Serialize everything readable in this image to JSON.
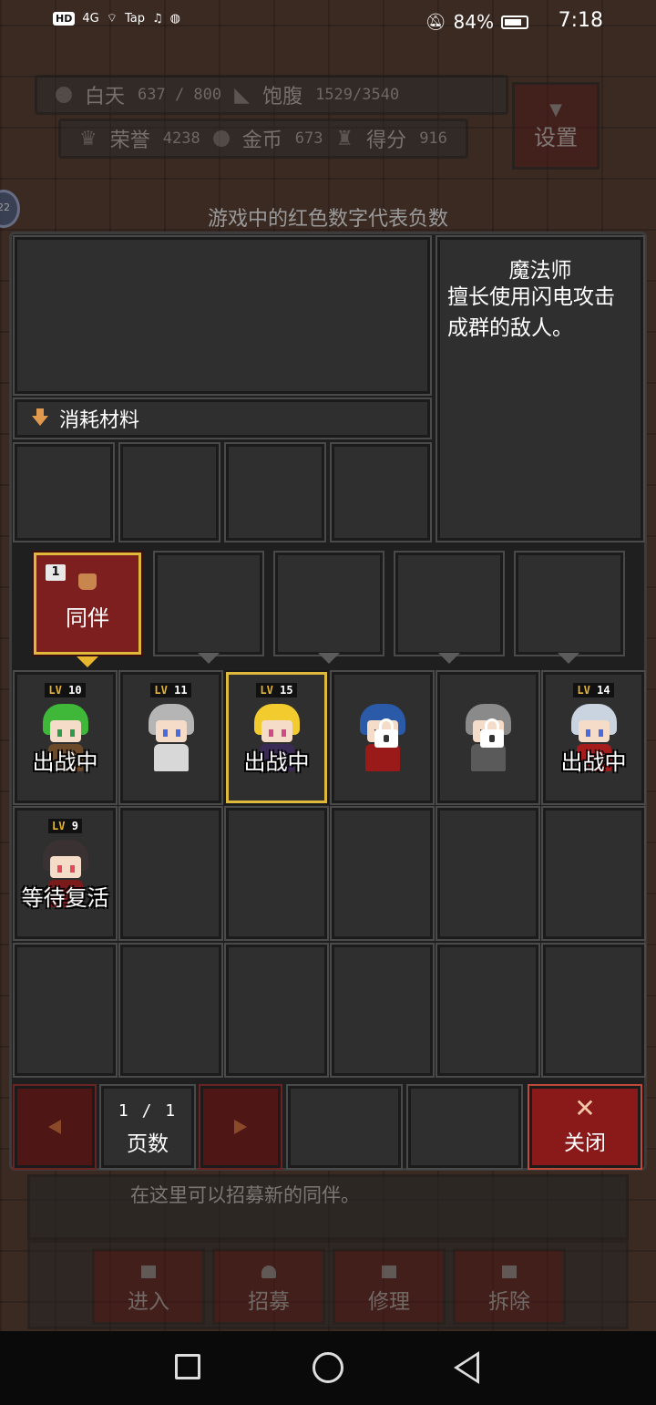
{
  "status_bar": {
    "network": "HD",
    "signal": "4G",
    "apps": "Tap",
    "battery": "84%",
    "time": "7:18"
  },
  "hud": {
    "day_label": "白天",
    "day_value": "637 / 800",
    "satiety_label": "饱腹",
    "satiety_value": "1529/3540",
    "honor_label": "荣誉",
    "honor_value": "4238",
    "gold_label": "金币",
    "gold_value": "673",
    "score_label": "得分",
    "score_value": "916",
    "settings_label": "设置"
  },
  "hint_top": "游戏中的红色数字代表负数",
  "side_badge": "22",
  "detail": {
    "class_name": "魔法师",
    "description": "擅长使用闪电攻击成群的敌人。",
    "consume_label": "消耗材料"
  },
  "team": {
    "slot1_badge": "1",
    "slot1_label": "同伴"
  },
  "heroes": [
    {
      "level": "10",
      "status": "出战中",
      "hair": "#3fb83a",
      "body": "#6b4a2a",
      "eye": "#2e9a4a"
    },
    {
      "level": "11",
      "status": "",
      "hair": "#b5b5b5",
      "body": "#d8d8d8",
      "eye": "#4a6ae0"
    },
    {
      "level": "15",
      "status": "出战中",
      "hair": "#f2cc2e",
      "body": "#3a2a55",
      "eye": "#d04a8a"
    },
    {
      "level": "",
      "status": "",
      "hair": "#2a5aa8",
      "body": "#9a1a1a",
      "eye": "#222222"
    },
    {
      "level": "",
      "status": "",
      "hair": "#8a8a8a",
      "body": "#5a5a5a",
      "eye": "#222222"
    },
    {
      "level": "14",
      "status": "出战中",
      "hair": "#c9d4e0",
      "body": "#a41c1c",
      "eye": "#4a6ae0"
    },
    {
      "level": "9",
      "status": "等待复活",
      "hair": "#3a3232",
      "body": "#7a1a1a",
      "eye": "#e04a5a"
    }
  ],
  "pager": {
    "count": "1 / 1",
    "label": "页数",
    "close_label": "关闭"
  },
  "bottom": {
    "hint": "在这里可以招募新的同伴。",
    "enter": "进入",
    "recruit": "招募",
    "repair": "修理",
    "demolish": "拆除"
  }
}
